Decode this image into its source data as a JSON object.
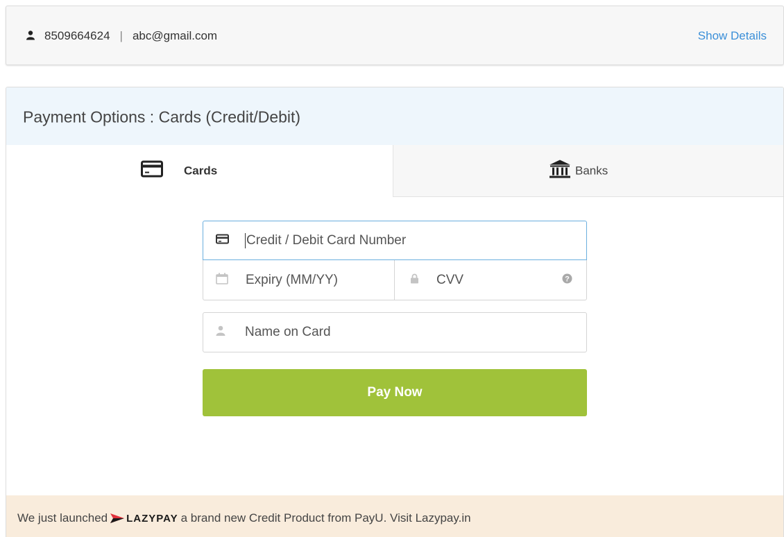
{
  "user": {
    "phone": "8509664624",
    "separator": "|",
    "email": "abc@gmail.com",
    "show_details_label": "Show Details",
    "icon": "user-icon"
  },
  "panel": {
    "title": "Payment Options : Cards (Credit/Debit)"
  },
  "tabs": [
    {
      "label": "Cards",
      "icon": "credit-card-icon",
      "active": true
    },
    {
      "label": "Banks",
      "icon": "bank-icon",
      "active": false
    }
  ],
  "form": {
    "card_number_placeholder": "Credit / Debit Card Number",
    "expiry_placeholder": "Expiry (MM/YY)",
    "cvv_placeholder": "CVV",
    "name_placeholder": "Name on Card",
    "pay_label": "Pay Now"
  },
  "promo": {
    "prefix": "We just launched",
    "brand": "LAZYPAY",
    "suffix": "a brand new Credit Product from PayU. Visit Lazypay.in"
  },
  "colors": {
    "link": "#3b8fd8",
    "pay_button": "#a0c23a",
    "active_input_border": "#6aaede",
    "header_bg": "#eef6fc",
    "promo_bg": "#f9ecdc",
    "brand_red": "#e0323c"
  }
}
